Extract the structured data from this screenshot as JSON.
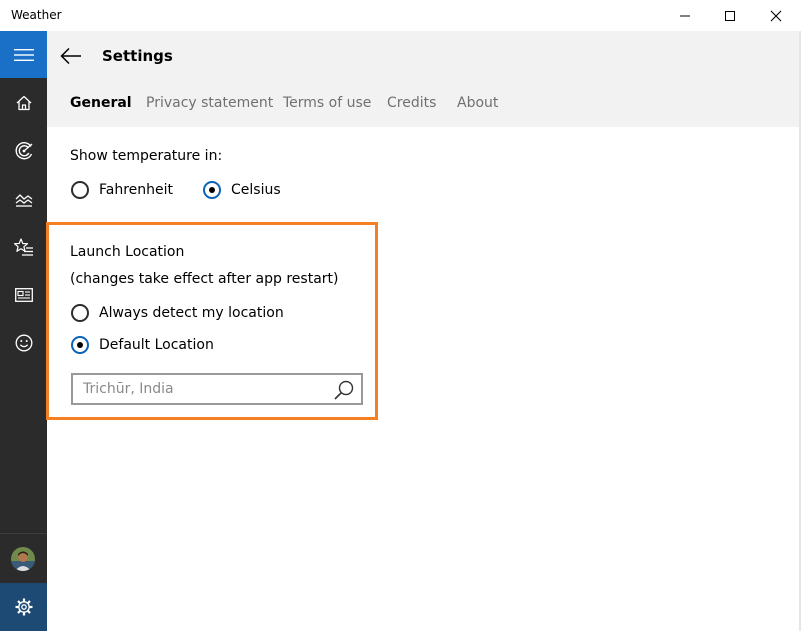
{
  "window": {
    "title": "Weather"
  },
  "colors": {
    "accent": "#1a6fc7",
    "sidebar_bg": "#2b2b2b",
    "highlight_border": "#f57f22",
    "header_bg": "#f2f2f2"
  },
  "sidebar": {
    "items": [
      {
        "icon": "home-icon"
      },
      {
        "icon": "forecast-icon"
      },
      {
        "icon": "historical-chart-icon"
      },
      {
        "icon": "favorites-icon"
      },
      {
        "icon": "news-icon"
      },
      {
        "icon": "smiley-icon"
      }
    ],
    "bottom": [
      {
        "icon": "avatar"
      },
      {
        "icon": "gear-icon"
      }
    ]
  },
  "header": {
    "title": "Settings",
    "tabs": [
      {
        "label": "General",
        "active": true
      },
      {
        "label": "Privacy statement",
        "active": false
      },
      {
        "label": "Terms of use",
        "active": false
      },
      {
        "label": "Credits",
        "active": false
      },
      {
        "label": "About",
        "active": false
      }
    ]
  },
  "temperature": {
    "label": "Show temperature in:",
    "options": [
      {
        "label": "Fahrenheit",
        "checked": false
      },
      {
        "label": "Celsius",
        "checked": true
      }
    ]
  },
  "launch_location": {
    "title": "Launch Location",
    "note": "(changes take effect after app restart)",
    "options": [
      {
        "label": "Always detect my location",
        "checked": false
      },
      {
        "label": "Default Location",
        "checked": true
      }
    ],
    "search": {
      "value": "",
      "placeholder": "Trichūr, India"
    }
  }
}
